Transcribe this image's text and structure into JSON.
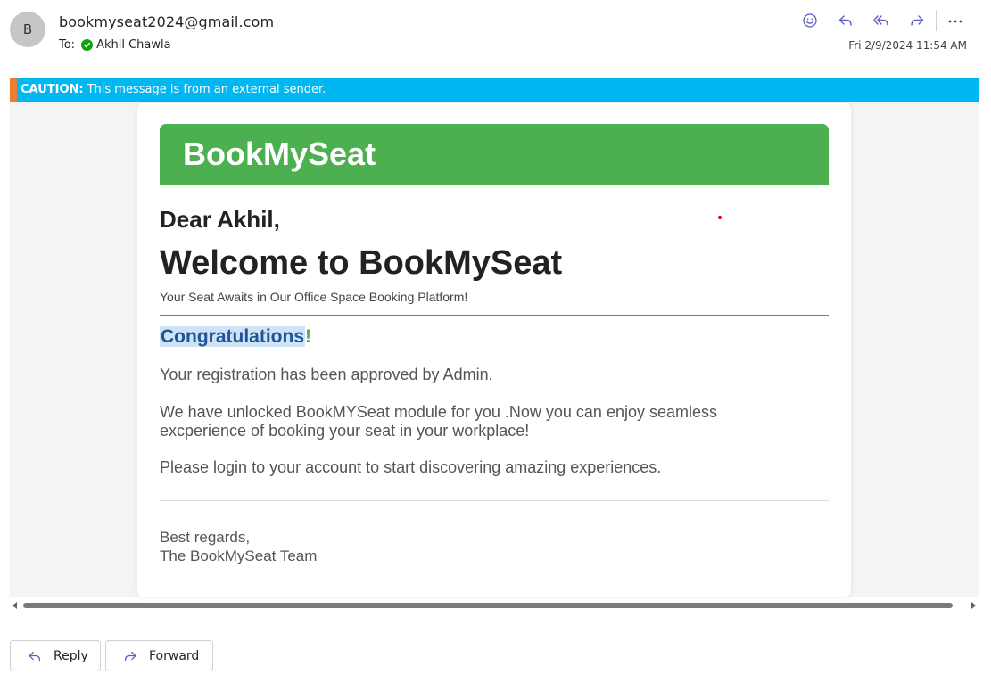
{
  "header": {
    "avatar_initial": "B",
    "sender": "bookmyseat2024@gmail.com",
    "to_label": "To:",
    "recipient": "Akhil Chawla",
    "timestamp": "Fri 2/9/2024 11:54 AM",
    "action_icons": [
      "emoji-icon",
      "reply-icon",
      "reply-all-icon",
      "forward-icon",
      "more-icon"
    ]
  },
  "caution": {
    "label": "CAUTION:",
    "text": "This message is from an external sender.",
    "bar_color": "#00b7f1",
    "accent_color": "#ed7d31"
  },
  "email": {
    "brand": "BookMySeat",
    "brand_color": "#4caf50",
    "greeting": "Dear Akhil,",
    "welcome": "Welcome to BookMySeat",
    "tagline": "Your Seat Awaits in Our Office Space Booking Platform!",
    "congrats_word": "Congratulations",
    "congrats_mark": "!",
    "paragraph1": "Your registration has been approved by Admin.",
    "paragraph2_line1": "We have unlocked BookMYSeat module for you .Now you can enjoy seamless",
    "paragraph2_line2": "excperience of booking your seat in your workplace!",
    "paragraph3": "Please login to your account to start discovering amazing experiences.",
    "signoff_line1": "Best regards,",
    "signoff_line2": "The BookMySeat Team"
  },
  "footer": {
    "reply_label": "Reply",
    "forward_label": "Forward"
  }
}
